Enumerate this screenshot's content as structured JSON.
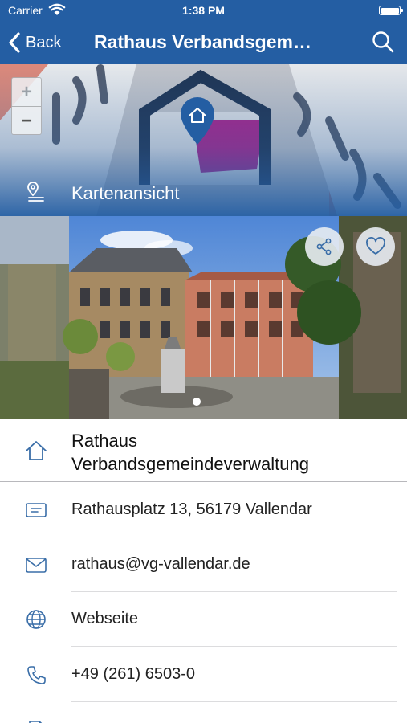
{
  "status_bar": {
    "carrier": "Carrier",
    "time": "1:38 PM"
  },
  "nav": {
    "back_label": "Back",
    "title": "Rathaus Verbandsgemeindeverwaltung"
  },
  "map": {
    "zoom_in": "+",
    "zoom_out": "−",
    "link_label": "Kartenansicht"
  },
  "place": {
    "name_line1": "Rathaus",
    "name_line2": "Verbandsgemeindeverwaltung"
  },
  "details": [
    {
      "icon": "address-card-icon",
      "text": "Rathausplatz 13, 56179 Vallendar"
    },
    {
      "icon": "mail-icon",
      "text": "rathaus@vg-vallendar.de"
    },
    {
      "icon": "globe-icon",
      "text": "Webseite"
    },
    {
      "icon": "phone-icon",
      "text": "+49 (261) 6503-0"
    }
  ],
  "colors": {
    "primary": "#245ea3",
    "icon": "#3a6ea8",
    "text": "#111111"
  }
}
